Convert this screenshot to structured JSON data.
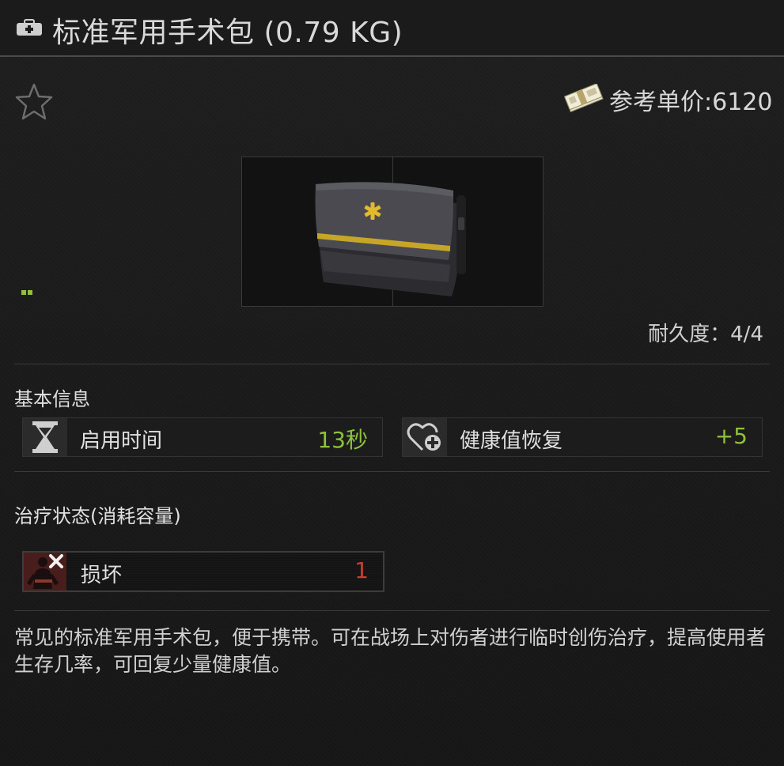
{
  "header": {
    "title": "标准军用手术包 (0.79 KG)",
    "icon": "medkit-icon"
  },
  "price": {
    "label": "参考单价:6120",
    "icon": "cash-stack-icon"
  },
  "item": {
    "image": "surgical-kit-bag-image",
    "durability": "耐久度：4/4"
  },
  "basic_info": {
    "title": "基本信息",
    "stats": [
      {
        "label": "启用时间",
        "value": "13秒",
        "icon": "hourglass-icon"
      },
      {
        "label": "健康值恢复",
        "value": "+5",
        "icon": "heart-plus-icon"
      }
    ]
  },
  "treatment": {
    "title": "治疗状态(消耗容量)",
    "statuses": [
      {
        "label": "损坏",
        "value": "1",
        "icon": "broken-limb-icon"
      }
    ]
  },
  "description": "常见的标准军用手术包，便于携带。可在战场上对伤者进行临时创伤治疗，提高使用者生存几率，可回复少量健康值。",
  "colors": {
    "positive": "#8fc23a",
    "negative": "#c8402c",
    "background": "#1a1a1a"
  }
}
